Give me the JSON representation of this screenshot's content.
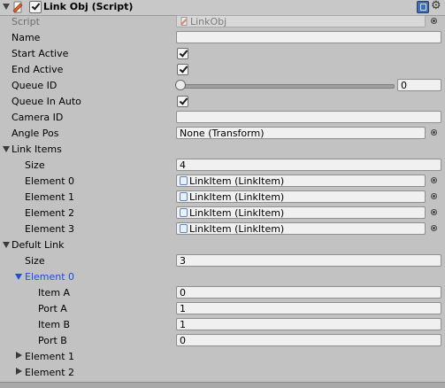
{
  "header": {
    "title": "Link Obj (Script)",
    "enabled": true,
    "icons": [
      "script-icon",
      "book-icon",
      "gear-icon"
    ]
  },
  "fields": {
    "script": {
      "label": "Script",
      "value": "LinkObj"
    },
    "name": {
      "label": "Name",
      "value": ""
    },
    "start_active": {
      "label": "Start Active",
      "checked": true
    },
    "end_active": {
      "label": "End Active",
      "checked": true
    },
    "queue_id": {
      "label": "Queue ID",
      "value": "0",
      "slider_fraction": 0
    },
    "queue_in_auto": {
      "label": "Queue In Auto",
      "checked": true
    },
    "camera_id": {
      "label": "Camera ID",
      "value": ""
    },
    "angle_pos": {
      "label": "Angle Pos",
      "value": "None (Transform)"
    }
  },
  "link_items": {
    "label": "Link Items",
    "size_label": "Size",
    "size": "4",
    "elements": [
      {
        "label": "Element 0",
        "value": "LinkItem (LinkItem)"
      },
      {
        "label": "Element 1",
        "value": "LinkItem (LinkItem)"
      },
      {
        "label": "Element 2",
        "value": "LinkItem (LinkItem)"
      },
      {
        "label": "Element 3",
        "value": "LinkItem (LinkItem)"
      }
    ]
  },
  "defult_link": {
    "label": "Defult Link",
    "size_label": "Size",
    "size": "3",
    "element0": {
      "label": "Element 0",
      "item_a": {
        "label": "Item A",
        "value": "0"
      },
      "port_a": {
        "label": "Port A",
        "value": "1"
      },
      "item_b": {
        "label": "Item B",
        "value": "1"
      },
      "port_b": {
        "label": "Port B",
        "value": "0"
      }
    },
    "element1": {
      "label": "Element 1"
    },
    "element2": {
      "label": "Element 2"
    }
  },
  "colors": {
    "background": "#c2c2c2",
    "selected_label": "#1a4fd6"
  }
}
